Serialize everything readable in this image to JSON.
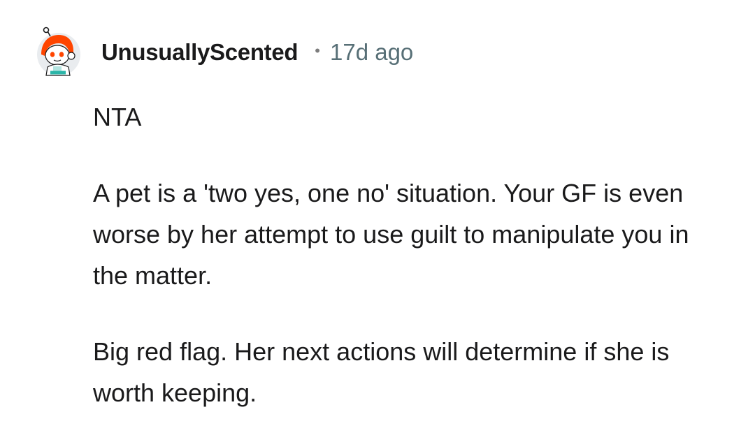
{
  "comment": {
    "author": "UnusuallyScented",
    "separator": "•",
    "timestamp": "17d ago",
    "avatar_icon": "snoo-avatar-icon",
    "paragraphs": [
      "NTA",
      "A pet is a 'two yes, one no' situation. Your GF is even worse by her attempt to use guilt to manipulate you in the matter.",
      "Big red flag. Her next actions will determine if she is worth keeping."
    ]
  },
  "colors": {
    "text": "#1a1a1b",
    "meta": "#576f76",
    "avatar_orange": "#ff4500",
    "avatar_teal": "#2bb5a8"
  }
}
